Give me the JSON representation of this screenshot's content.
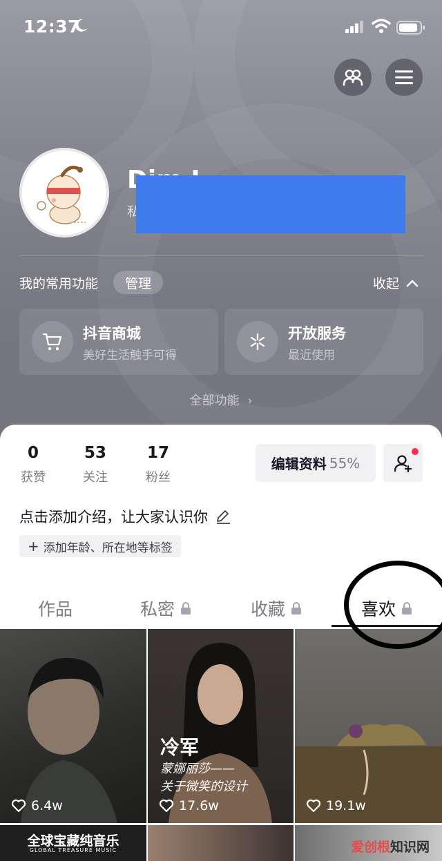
{
  "status": {
    "time": "12:37"
  },
  "profile": {
    "name": "Dim   L ",
    "subline": "私"
  },
  "functions": {
    "title": "我的常用功能",
    "manage": "管理",
    "collapse": "收起",
    "cards": [
      {
        "name": "抖音商城",
        "desc": "美好生活触手可得",
        "icon": "cart-icon"
      },
      {
        "name": "开放服务",
        "desc": "最近使用",
        "icon": "sparkle-icon"
      }
    ],
    "all": "全部功能"
  },
  "stats": [
    {
      "num": "0",
      "label": "获赞"
    },
    {
      "num": "53",
      "label": "关注"
    },
    {
      "num": "17",
      "label": "粉丝"
    }
  ],
  "edit": {
    "label": "编辑资料",
    "percent": "55%"
  },
  "bio": "点击添加介绍，让大家认识你",
  "tag": "添加年龄、所在地等标签",
  "tabs": [
    {
      "label": "作品",
      "locked": false
    },
    {
      "label": "私密",
      "locked": true
    },
    {
      "label": "收藏",
      "locked": true
    },
    {
      "label": "喜欢",
      "locked": true,
      "active": true
    }
  ],
  "videos": [
    {
      "likes": "6.4w"
    },
    {
      "likes": "17.6w",
      "title": "冷军",
      "subtitle1": "蒙娜丽莎——",
      "subtitle2": "关于微笑的设计"
    },
    {
      "likes": "19.1w"
    }
  ],
  "next_row": {
    "banner": "全球宝藏纯音乐",
    "banner_sub": "GLOBAL TREASURE MUSIC",
    "watermark_a": "爱创根",
    "watermark_b": "知识网"
  },
  "colors": {
    "accent": "#fe2c55",
    "redaction": "#3e7cee",
    "text": "#161823"
  }
}
